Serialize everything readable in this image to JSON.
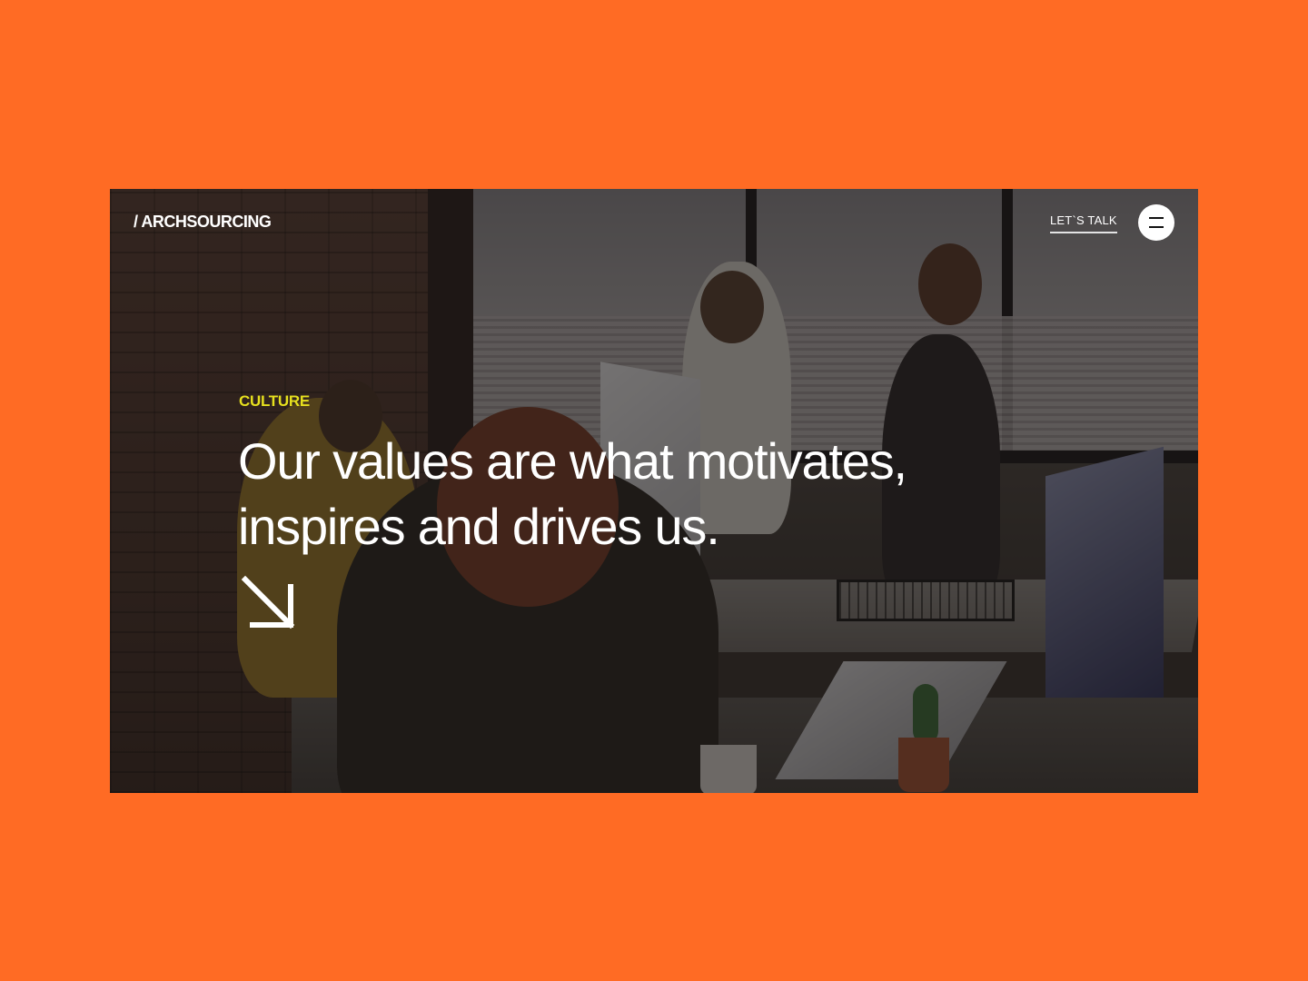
{
  "header": {
    "logo_text": "/ ARCHSOURCING",
    "cta_label": "LET`S TALK",
    "menu_icon": "hamburger-icon"
  },
  "hero": {
    "eyebrow": "CULTURE",
    "headline_line1": "Our values are what motivates,",
    "headline_line2": "inspires and drives us.",
    "arrow_icon": "arrow-down-right-icon",
    "background_image": "office team working photo"
  },
  "colors": {
    "page_background": "#ff6b24",
    "eyebrow": "#e6e01e",
    "text": "#ffffff"
  }
}
